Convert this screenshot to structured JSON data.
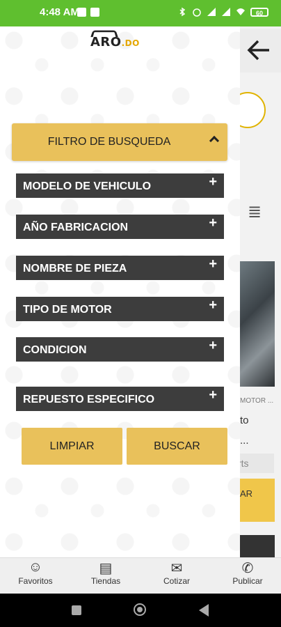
{
  "status_bar": {
    "time": "4:48 AM",
    "battery": "60"
  },
  "logo": {
    "main": "ARO",
    "suffix": ".DO"
  },
  "filter": {
    "title": "FILTRO DE BUSQUEDA",
    "options": [
      "MODELO DE VEHICULO",
      "AÑO FABRICACION",
      "NOMBRE DE PIEZA",
      "TIPO DE MOTOR",
      "CONDICION",
      "REPUESTO ESPECIFICO"
    ],
    "plus_symbol": "+"
  },
  "buttons": {
    "clear": "LIMPIAR",
    "search": "BUSCAR"
  },
  "background": {
    "item_subtitle": "MOTOR ...",
    "item_line1": "to",
    "item_line2": "...",
    "pill": "rts",
    "yellow_label": "AR"
  },
  "bottom_nav": [
    {
      "label": "Favoritos",
      "icon": "smiley-icon"
    },
    {
      "label": "Tiendas",
      "icon": "store-icon"
    },
    {
      "label": "Cotizar",
      "icon": "chat-money-icon"
    },
    {
      "label": "Publicar",
      "icon": "megaphone-icon"
    }
  ],
  "colors": {
    "status_bar": "#5fbf2f",
    "accent": "#e9c15b",
    "option_bg": "#3d3d3d"
  }
}
